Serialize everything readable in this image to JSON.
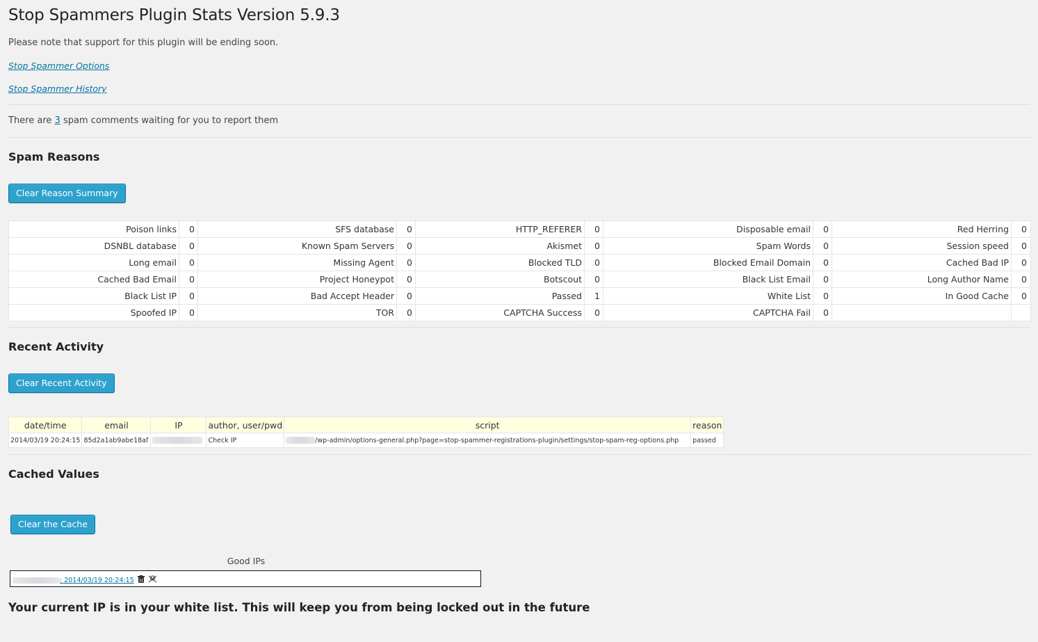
{
  "title": "Stop Spammers Plugin Stats Version 5.9.3",
  "notice": "Please note that support for this plugin will be ending soon.",
  "links": {
    "options": "Stop Spammer Options",
    "history": "Stop Spammer History"
  },
  "waiting": {
    "before": "There are ",
    "count": "3",
    "after": " spam comments waiting for you to report them"
  },
  "spam_reasons": {
    "heading": "Spam Reasons",
    "clear_button": "Clear Reason Summary",
    "rows": [
      [
        [
          "Poison links",
          "0"
        ],
        [
          "SFS database",
          "0"
        ],
        [
          "HTTP_REFERER",
          "0"
        ],
        [
          "Disposable email",
          "0"
        ],
        [
          "Red Herring",
          "0"
        ]
      ],
      [
        [
          "DSNBL database",
          "0"
        ],
        [
          "Known Spam Servers",
          "0"
        ],
        [
          "Akismet",
          "0"
        ],
        [
          "Spam Words",
          "0"
        ],
        [
          "Session speed",
          "0"
        ]
      ],
      [
        [
          "Long email",
          "0"
        ],
        [
          "Missing Agent",
          "0"
        ],
        [
          "Blocked TLD",
          "0"
        ],
        [
          "Blocked Email Domain",
          "0"
        ],
        [
          "Cached Bad IP",
          "0"
        ]
      ],
      [
        [
          "Cached Bad Email",
          "0"
        ],
        [
          "Project Honeypot",
          "0"
        ],
        [
          "Botscout",
          "0"
        ],
        [
          "Black List Email",
          "0"
        ],
        [
          "Long Author Name",
          "0"
        ]
      ],
      [
        [
          "Black List IP",
          "0"
        ],
        [
          "Bad Accept Header",
          "0"
        ],
        [
          "Passed",
          "1"
        ],
        [
          "White List",
          "0"
        ],
        [
          "In Good Cache",
          "0"
        ]
      ],
      [
        [
          "Spoofed IP",
          "0"
        ],
        [
          "TOR",
          "0"
        ],
        [
          "CAPTCHA Success",
          "0"
        ],
        [
          "CAPTCHA Fail",
          "0"
        ],
        [
          "",
          ""
        ]
      ]
    ]
  },
  "recent_activity": {
    "heading": "Recent Activity",
    "clear_button": "Clear Recent Activity",
    "columns": [
      "date/time",
      "email",
      "IP",
      "author, user/pwd",
      "script",
      "reason"
    ],
    "row": {
      "datetime": "2014/03/19 20:24:15",
      "email": "85d2a1ab9abe18af",
      "author": "Check IP",
      "script": "/wp-admin/options-general.php?page=stop-spammer-registrations-plugin/settings/stop-spam-reg-options.php",
      "reason": "passed"
    }
  },
  "cached": {
    "heading": "Cached Values",
    "clear_button": "Clear the Cache",
    "good_ips_label": "Good IPs",
    "entry_time": ": 2014/03/19 20:24:15"
  },
  "whitelist_message": "Your current IP is in your white list. This will keep you from being locked out in the future"
}
